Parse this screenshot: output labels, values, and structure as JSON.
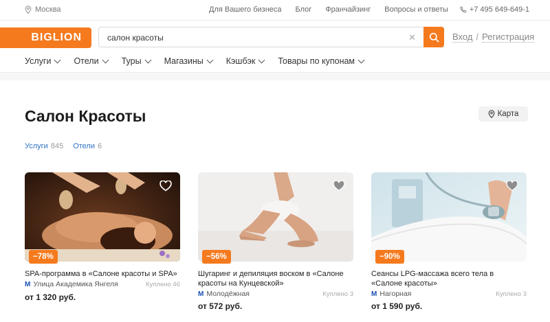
{
  "topbar": {
    "city": "Москва",
    "links": [
      "Для Вашего бизнеса",
      "Блог",
      "Франчайзинг",
      "Вопросы и ответы"
    ],
    "phone": "+7 495 649-649-1"
  },
  "header": {
    "logo": "BIGLION",
    "search_value": "салон красоты",
    "login": "Вход",
    "register": "Регистрация"
  },
  "nav": [
    "Услуги",
    "Отели",
    "Туры",
    "Магазины",
    "Кэшбэк",
    "Товары по купонам"
  ],
  "page": {
    "title": "Салон Красоты",
    "map_label": "Карта",
    "filters": [
      {
        "label": "Услуги",
        "count": "845"
      },
      {
        "label": "Отели",
        "count": "6"
      }
    ]
  },
  "cards": [
    {
      "discount": "−78%",
      "title": "SPA-программа в «Салоне красоты и SPA»",
      "metro": "Улица Академика Янгеля",
      "bought": "Куплено 46",
      "price": "от 1 320 руб."
    },
    {
      "discount": "−56%",
      "title": "Шугаринг и депиляция воском в «Салоне красоты на Кунцевской»",
      "metro": "Молодёжная",
      "bought": "Куплено 3",
      "price": "от 572 руб."
    },
    {
      "discount": "−90%",
      "title": "Сеансы LPG-массажа всего тела в «Салоне красоты»",
      "metro": "Нагорная",
      "bought": "Куплено 3",
      "price": "от 1 590 руб."
    }
  ],
  "colors": {
    "brand": "#f57a1e",
    "link": "#2f72c8",
    "metro": "#1a4fb5"
  },
  "icons": [
    "location-pin-icon",
    "phone-icon",
    "search-icon",
    "close-icon",
    "chevron-down-icon",
    "heart-icon",
    "metro-icon"
  ]
}
